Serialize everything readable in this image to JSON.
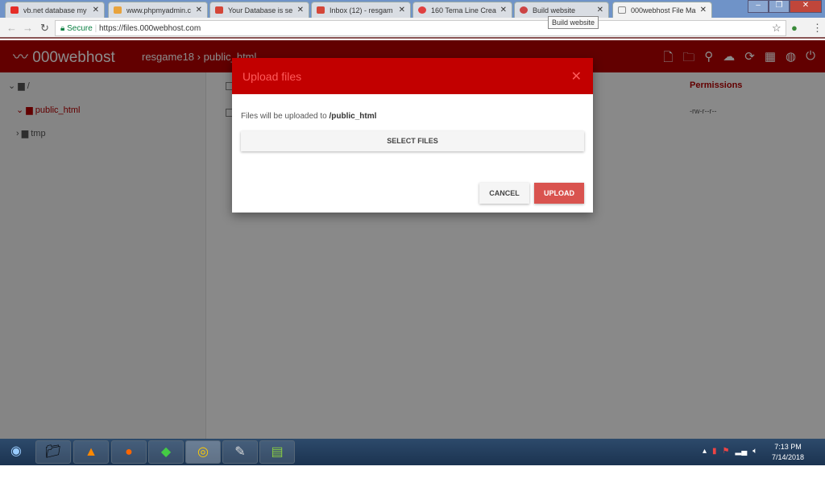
{
  "browser": {
    "tabs": [
      {
        "title": "vb.net database my",
        "color": "#e52d27"
      },
      {
        "title": "www.phpmyadmin.c",
        "color": "#e8a33d"
      },
      {
        "title": "Your Database is se",
        "color": "#d44638"
      },
      {
        "title": "Inbox (12) - resgam",
        "color": "#d44638"
      },
      {
        "title": "160 Tema Line Crea",
        "color": "#e04040"
      },
      {
        "title": "Build website",
        "color": "#c44"
      },
      {
        "title": "000webhost File Ma",
        "color": "#888"
      }
    ],
    "tab_close": "✕",
    "secure": "Secure",
    "url": "https://files.000webhost.com",
    "tooltip": "Build website"
  },
  "app": {
    "logo": "000webhost",
    "breadcrumb_user": "resgame18",
    "breadcrumb_sep": "›",
    "breadcrumb_folder": "public_html",
    "tree": {
      "root": "/",
      "public_html": "public_html",
      "tmp": "tmp"
    },
    "permissions_header": "Permissions",
    "permissions_value": "-rw-r--r--"
  },
  "modal": {
    "title": "Upload files",
    "close": "✕",
    "info_prefix": "Files will be uploaded to ",
    "info_path": "/public_html",
    "select_files": "SELECT FILES",
    "cancel": "CANCEL",
    "upload": "UPLOAD"
  },
  "taskbar": {
    "time": "7:13 PM",
    "date": "7/14/2018"
  }
}
